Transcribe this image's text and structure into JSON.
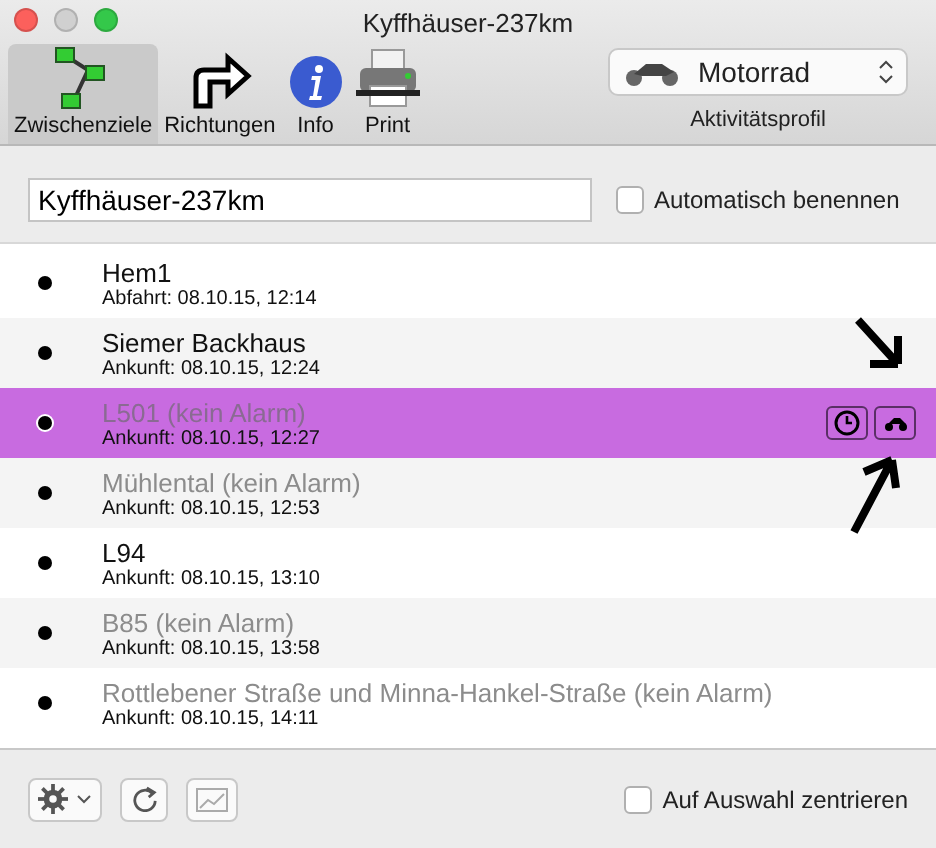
{
  "window": {
    "title": "Kyffhäuser-237km"
  },
  "toolbar": {
    "items": [
      {
        "label": "Zwischenziele",
        "kind": "waypoints",
        "selected": true
      },
      {
        "label": "Richtungen",
        "kind": "directions",
        "selected": false
      },
      {
        "label": "Info",
        "kind": "info",
        "selected": false
      },
      {
        "label": "Print",
        "kind": "print",
        "selected": false
      }
    ],
    "profile": {
      "value": "Motorrad",
      "label": "Aktivitätsprofil"
    }
  },
  "route_name": {
    "value": "Kyffhäuser-237km"
  },
  "auto_name": {
    "label": "Automatisch benennen",
    "checked": false
  },
  "waypoints": [
    {
      "name": "Hem1",
      "detail": "Abfahrt: 08.10.15, 12:14",
      "alarm": true,
      "selected": false
    },
    {
      "name": "Siemer Backhaus",
      "detail": "Ankunft: 08.10.15, 12:24",
      "alarm": true,
      "selected": false
    },
    {
      "name": "L501 (kein Alarm)",
      "detail": "Ankunft: 08.10.15, 12:27",
      "alarm": false,
      "selected": true
    },
    {
      "name": "Mühlental (kein Alarm)",
      "detail": "Ankunft: 08.10.15, 12:53",
      "alarm": false,
      "selected": false
    },
    {
      "name": "L94",
      "detail": "Ankunft: 08.10.15, 13:10",
      "alarm": true,
      "selected": false
    },
    {
      "name": "B85 (kein Alarm)",
      "detail": "Ankunft: 08.10.15, 13:58",
      "alarm": false,
      "selected": false
    },
    {
      "name": "Rottlebener Straße und Minna-Hankel-Straße (kein Alarm)",
      "detail": "Ankunft: 08.10.15, 14:11",
      "alarm": false,
      "selected": false
    }
  ],
  "footer": {
    "center": {
      "label": "Auf Auswahl zentrieren",
      "checked": false
    }
  }
}
